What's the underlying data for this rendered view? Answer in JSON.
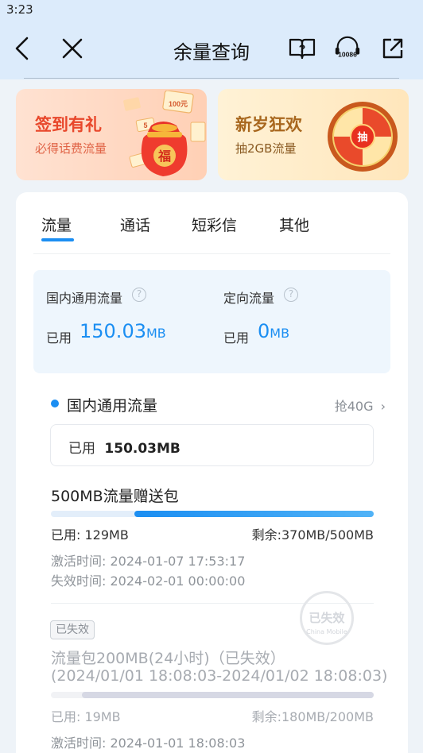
{
  "status_bar": {
    "time": "3:23"
  },
  "nav": {
    "title": "余量查询",
    "service_number": "10086"
  },
  "banners": [
    {
      "title": "签到有礼",
      "subtitle": "必得话费流量",
      "badge": "福",
      "coupon_text": "100元"
    },
    {
      "title": "新岁狂欢",
      "subtitle": "抽2GB流量",
      "wheel_text": "抽"
    }
  ],
  "tabs": [
    {
      "label": "流量",
      "active": true
    },
    {
      "label": "通话",
      "active": false
    },
    {
      "label": "短彩信",
      "active": false
    },
    {
      "label": "其他",
      "active": false
    }
  ],
  "summary": {
    "domestic": {
      "label": "国内通用流量",
      "used_label": "已用",
      "value": "150.03",
      "unit": "MB"
    },
    "directed": {
      "label": "定向流量",
      "used_label": "已用",
      "value": "0",
      "unit": "MB"
    }
  },
  "section": {
    "title": "国内通用流量",
    "link": "抢40G",
    "used_box_label": "已用",
    "used_box_value": "150.03MB"
  },
  "package_1": {
    "title": "500MB流量赠送包",
    "used": "已用: 129MB",
    "remaining": "剩余:370MB/500MB",
    "used_fraction": 0.258,
    "activated": "激活时间: 2024-01-07 17:53:17",
    "expires": "失效时间: 2024-02-01 00:00:00"
  },
  "package_2": {
    "badge": "已失效",
    "stamp": "已失效",
    "stamp_sub": "China Mobile",
    "title_line1": "流量包200MB(24小时)（已失效）",
    "title_line2": "(2024/01/01 18:08:03-2024/01/02 18:08:03)",
    "used": "已用: 19MB",
    "remaining": "剩余:180MB/200MB",
    "used_fraction": 0.095,
    "activated": "激活时间: 2024-01-01 18:08:03"
  },
  "colors": {
    "accent": "#1b8ef2",
    "header_bg": "#dcebfb",
    "banner1_text": "#e8472b",
    "banner2_text": "#a8671e"
  }
}
